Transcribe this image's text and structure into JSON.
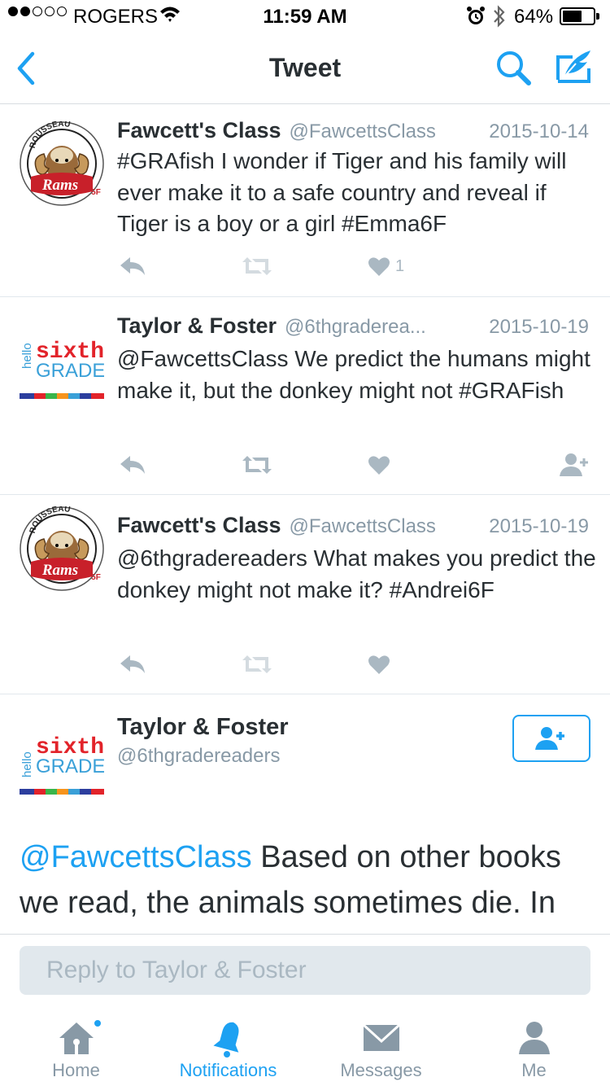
{
  "status_bar": {
    "carrier": "ROGERS",
    "time": "11:59 AM",
    "battery": "64%",
    "battery_level": 0.64,
    "signal_bars": 2,
    "icons": [
      "signal-dots",
      "wifi-icon",
      "alarm-icon",
      "bluetooth-icon",
      "battery-icon"
    ]
  },
  "nav": {
    "title": "Tweet",
    "back_icon": "chevron-left-icon",
    "search_icon": "search-icon",
    "compose_icon": "compose-icon"
  },
  "tweets": [
    {
      "name": "Fawcett's Class",
      "handle": "@FawcettsClass",
      "date": "2015-10-14",
      "text": "#GRAfish I wonder if Tiger and his family will ever make it to a safe country and reveal if Tiger is a boy or a girl #Emma6F",
      "like_count": "1",
      "avatar": "rousseau-rams-logo"
    },
    {
      "name": "Taylor & Foster",
      "handle": "@6thgraderea...",
      "date": "2015-10-19",
      "text": "@FawcettsClass We predict the humans might make it, but the donkey might not #GRAFish",
      "avatar": "hello-sixth-grade-logo"
    },
    {
      "name": "Fawcett's Class",
      "handle": "@FawcettsClass",
      "date": "2015-10-19",
      "text": "@6thgradereaders What makes you predict the donkey might not make it? #Andrei6F",
      "avatar": "rousseau-rams-logo"
    }
  ],
  "main_tweet": {
    "name": "Taylor & Foster",
    "handle": "@6thgradereaders",
    "mention": "@FawcettsClass",
    "text": " Based on other books we read, the animals sometimes die. In this book, the ocean may be a lack of"
  },
  "reply": {
    "placeholder": "Reply to Taylor & Foster"
  },
  "tabs": [
    {
      "label": "Home",
      "icon": "home-icon",
      "active": false,
      "has_badge": true
    },
    {
      "label": "Notifications",
      "icon": "bell-icon",
      "active": true,
      "has_badge": false
    },
    {
      "label": "Messages",
      "icon": "envelope-icon",
      "active": false,
      "has_badge": false
    },
    {
      "label": "Me",
      "icon": "person-icon",
      "active": false,
      "has_badge": false
    }
  ],
  "colors": {
    "accent": "#1da1f2",
    "muted": "#8899a6",
    "action_icon": "#aab8c2",
    "text": "#292f33"
  },
  "avatar_text": {
    "rams_top": "ROUSSEAU",
    "rams_main": "Rams",
    "rams_grade": "5F",
    "sixth_hello": "hello",
    "sixth_top": "sixth",
    "sixth_bottom": "GRADE"
  }
}
